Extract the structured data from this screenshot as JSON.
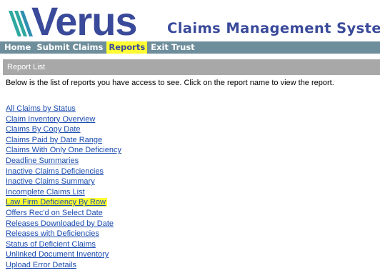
{
  "header": {
    "logo_text": "Verus",
    "app_title": "Claims Management System"
  },
  "nav": {
    "items": [
      {
        "label": "Home"
      },
      {
        "label": "Submit Claims"
      },
      {
        "label": "Reports"
      },
      {
        "label": "Exit Trust"
      }
    ],
    "active_index": 2
  },
  "section": {
    "title": "Report List",
    "intro": "Below is the list of reports you have access to see. Click on the report name to view the report."
  },
  "reports": [
    {
      "label": "All Claims by Status"
    },
    {
      "label": "Claim Inventory Overview"
    },
    {
      "label": "Claims By Copy Date"
    },
    {
      "label": "Claims Paid by Date Range"
    },
    {
      "label": "Claims With Only One Deficiency"
    },
    {
      "label": "Deadline Summaries"
    },
    {
      "label": "Inactive Claims Deficiencies"
    },
    {
      "label": "Inactive Claims Summary"
    },
    {
      "label": "Incomplete Claims List"
    },
    {
      "label": "Law Firm Deficiency By Row"
    },
    {
      "label": "Offers Rec'd on Select Date"
    },
    {
      "label": "Releases Downloaded by Date"
    },
    {
      "label": "Releases with Deficiencies"
    },
    {
      "label": "Status of Deficient Claims"
    },
    {
      "label": "Unlinked Document Inventory"
    },
    {
      "label": "Upload Error Details"
    }
  ],
  "highlighted_report_index": 9,
  "colors": {
    "brand": "#3a4a9a",
    "nav_bg": "#6f8e9c",
    "highlight": "#ffff33",
    "link": "#1a4bb0",
    "section_bg": "#a8a8a8"
  }
}
